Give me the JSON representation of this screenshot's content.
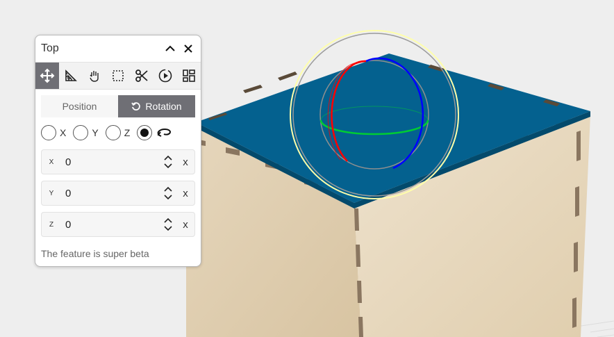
{
  "panel": {
    "title": "Top",
    "collapse_icon": "chevron-up-icon",
    "close_icon": "close-icon"
  },
  "toolbar": {
    "tools": [
      {
        "name": "move",
        "icon": "move-arrows-icon",
        "active": true
      },
      {
        "name": "measure",
        "icon": "ruler-triangle-icon",
        "active": false
      },
      {
        "name": "pan",
        "icon": "hand-icon",
        "active": false
      },
      {
        "name": "select",
        "icon": "dashed-select-icon",
        "active": false
      },
      {
        "name": "cut",
        "icon": "scissors-icon",
        "active": false
      },
      {
        "name": "animate",
        "icon": "play-circle-icon",
        "active": false
      },
      {
        "name": "layout",
        "icon": "grid-layout-icon",
        "active": false
      }
    ]
  },
  "tabs": {
    "position_label": "Position",
    "rotation_label": "Rotation",
    "active": "Rotation"
  },
  "axes": {
    "options": [
      "X",
      "Y",
      "Z"
    ],
    "selected": "free",
    "free_icon": "free-rotate-icon"
  },
  "fields": [
    {
      "label": "X",
      "value": "0",
      "clear": "x"
    },
    {
      "label": "Y",
      "value": "0",
      "clear": "x"
    },
    {
      "label": "Z",
      "value": "0",
      "clear": "x"
    }
  ],
  "note": "The feature is super beta",
  "colors": {
    "accent": "#6f6f75",
    "box_top": "#04618f",
    "wood": "#e2d0b2",
    "gizmo_x": "#ff0000",
    "gizmo_y": "#00cc00",
    "gizmo_z": "#0000ff",
    "gizmo_outer": "#ffffaa"
  }
}
